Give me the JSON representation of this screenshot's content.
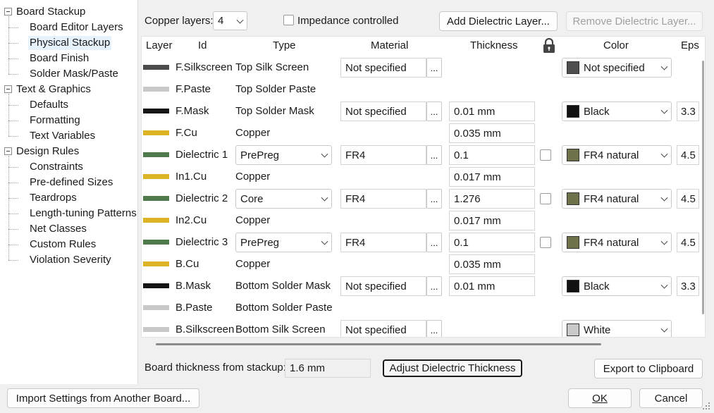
{
  "tree": {
    "items": [
      {
        "label": "Board Stackup",
        "level": 0,
        "expander": true
      },
      {
        "label": "Board Editor Layers",
        "level": 1
      },
      {
        "label": "Physical Stackup",
        "level": 1,
        "selected": true
      },
      {
        "label": "Board Finish",
        "level": 1
      },
      {
        "label": "Solder Mask/Paste",
        "level": 1
      },
      {
        "label": "Text & Graphics",
        "level": 0,
        "expander": true
      },
      {
        "label": "Defaults",
        "level": 1
      },
      {
        "label": "Formatting",
        "level": 1
      },
      {
        "label": "Text Variables",
        "level": 1
      },
      {
        "label": "Design Rules",
        "level": 0,
        "expander": true
      },
      {
        "label": "Constraints",
        "level": 1
      },
      {
        "label": "Pre-defined Sizes",
        "level": 1
      },
      {
        "label": "Teardrops",
        "level": 1
      },
      {
        "label": "Length-tuning Patterns",
        "level": 1
      },
      {
        "label": "Net Classes",
        "level": 1
      },
      {
        "label": "Custom Rules",
        "level": 1
      },
      {
        "label": "Violation Severity",
        "level": 1
      }
    ]
  },
  "toolbar": {
    "copper_layers_label": "Copper layers:",
    "copper_layers_value": "4",
    "impedance_label": "Impedance controlled",
    "add_dielectric": "Add Dielectric Layer...",
    "remove_dielectric": "Remove Dielectric Layer..."
  },
  "headers": {
    "layer": "Layer",
    "id": "Id",
    "type": "Type",
    "material": "Material",
    "thickness": "Thickness",
    "lock_icon": "lock-icon",
    "color": "Color",
    "eps": "Eps"
  },
  "rows": [
    {
      "swatch": "#4b4b4b",
      "id": "F.Silkscreen",
      "type": "Top Silk Screen",
      "type_combo": false,
      "material": "Not specified",
      "thickness": "",
      "lock": false,
      "color_name": "Not specified",
      "color_swatch": "#4f4f4f",
      "eps": ""
    },
    {
      "swatch": "#c8c8c8",
      "id": "F.Paste",
      "type": "Top Solder Paste",
      "type_combo": false,
      "material": "",
      "thickness": "",
      "lock": false,
      "color_name": "",
      "color_swatch": "",
      "eps": ""
    },
    {
      "swatch": "#141414",
      "id": "F.Mask",
      "type": "Top Solder Mask",
      "type_combo": false,
      "material": "Not specified",
      "thickness": "0.01 mm",
      "lock": false,
      "color_name": "Black",
      "color_swatch": "#111111",
      "eps": "3.3"
    },
    {
      "swatch": "#dcb325",
      "id": "F.Cu",
      "type": "Copper",
      "type_combo": false,
      "material": "",
      "thickness": "0.035 mm",
      "lock": false,
      "color_name": "",
      "color_swatch": "",
      "eps": ""
    },
    {
      "swatch": "#4f7a4c",
      "id": "Dielectric 1",
      "type": "PrePreg",
      "type_combo": true,
      "material": "FR4",
      "thickness": "0.1",
      "lock": true,
      "color_name": "FR4 natural",
      "color_swatch": "#6f714a",
      "eps": "4.5"
    },
    {
      "swatch": "#dcb325",
      "id": "In1.Cu",
      "type": "Copper",
      "type_combo": false,
      "material": "",
      "thickness": "0.017 mm",
      "lock": false,
      "color_name": "",
      "color_swatch": "",
      "eps": ""
    },
    {
      "swatch": "#4f7a4c",
      "id": "Dielectric 2",
      "type": "Core",
      "type_combo": true,
      "material": "FR4",
      "thickness": "1.276",
      "lock": true,
      "color_name": "FR4 natural",
      "color_swatch": "#6f714a",
      "eps": "4.5"
    },
    {
      "swatch": "#dcb325",
      "id": "In2.Cu",
      "type": "Copper",
      "type_combo": false,
      "material": "",
      "thickness": "0.017 mm",
      "lock": false,
      "color_name": "",
      "color_swatch": "",
      "eps": ""
    },
    {
      "swatch": "#4f7a4c",
      "id": "Dielectric 3",
      "type": "PrePreg",
      "type_combo": true,
      "material": "FR4",
      "thickness": "0.1",
      "lock": true,
      "color_name": "FR4 natural",
      "color_swatch": "#6f714a",
      "eps": "4.5"
    },
    {
      "swatch": "#dcb325",
      "id": "B.Cu",
      "type": "Copper",
      "type_combo": false,
      "material": "",
      "thickness": "0.035 mm",
      "lock": false,
      "color_name": "",
      "color_swatch": "",
      "eps": ""
    },
    {
      "swatch": "#141414",
      "id": "B.Mask",
      "type": "Bottom Solder Mask",
      "type_combo": false,
      "material": "Not specified",
      "thickness": "0.01 mm",
      "lock": false,
      "color_name": "Black",
      "color_swatch": "#111111",
      "eps": "3.3"
    },
    {
      "swatch": "#c8c8c8",
      "id": "B.Paste",
      "type": "Bottom Solder Paste",
      "type_combo": false,
      "material": "",
      "thickness": "",
      "lock": false,
      "color_name": "",
      "color_swatch": "",
      "eps": ""
    },
    {
      "swatch": "#c8c8c8",
      "id": "B.Silkscreen",
      "type": "Bottom Silk Screen",
      "type_combo": false,
      "material": "Not specified",
      "thickness": "",
      "lock": false,
      "color_name": "White",
      "color_swatch": "#c8c8c8",
      "eps": ""
    }
  ],
  "footer": {
    "board_thickness_label": "Board thickness from stackup:",
    "board_thickness_value": "1.6 mm",
    "adjust_button": "Adjust Dielectric Thickness",
    "export_button": "Export to Clipboard",
    "import_button": "Import Settings from Another Board...",
    "ok_button": "OK",
    "cancel_button": "Cancel"
  },
  "ellipsis": "..."
}
